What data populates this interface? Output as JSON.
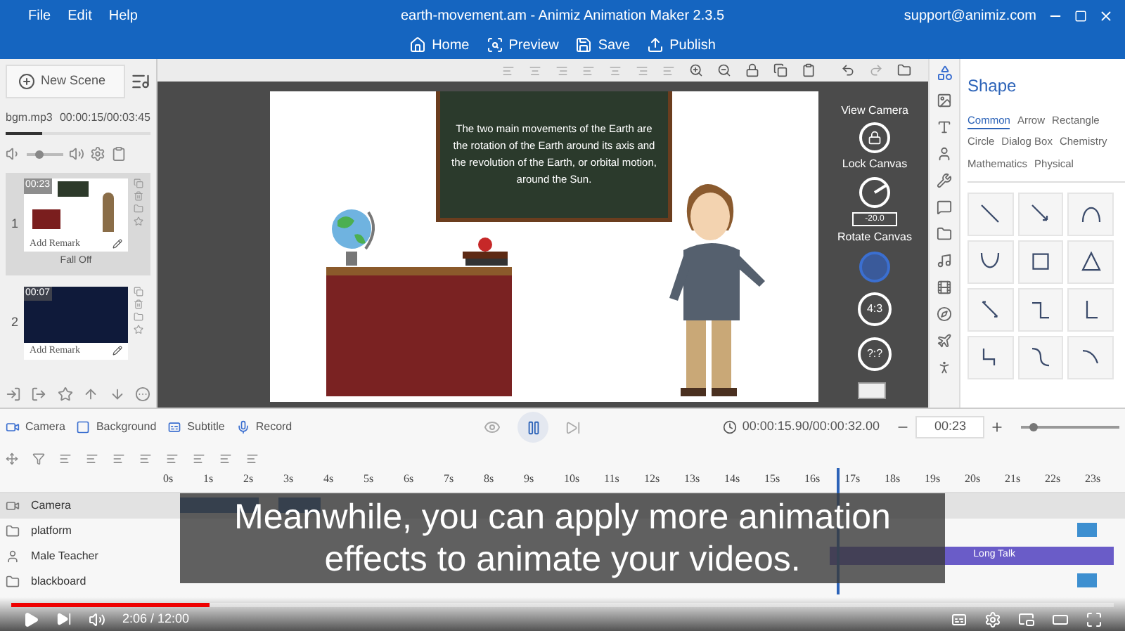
{
  "menu": [
    "File",
    "Edit",
    "Help"
  ],
  "window": {
    "title": "earth-movement.am - Animiz Animation Maker 2.3.5",
    "account": "support@animiz.com"
  },
  "toolbar": [
    {
      "label": "Home",
      "kind": "home"
    },
    {
      "label": "Preview",
      "kind": "preview"
    },
    {
      "label": "Save",
      "kind": "save"
    },
    {
      "label": "Publish",
      "kind": "publish"
    }
  ],
  "scene_panel": {
    "new_scene": "New Scene",
    "music": {
      "file": "bgm.mp3",
      "time": "00:00:15/00:03:45",
      "level": 0.25
    },
    "volume": {
      "level": 0.3
    },
    "scenes": [
      {
        "number": "1",
        "duration": "00:23",
        "remark": "Add Remark",
        "transition": "Fall Off",
        "selected": true,
        "kind": "classroom"
      },
      {
        "number": "2",
        "duration": "00:07",
        "remark": "Add Remark",
        "selected": false,
        "kind": "night"
      }
    ]
  },
  "canvas": {
    "blackboard_text": "The two main movements of the Earth are the rotation of the Earth around its axis and the revolution of the Earth, or orbital motion, around the Sun."
  },
  "camera_controls": {
    "view_camera": "View Camera",
    "lock_canvas": "Lock Canvas",
    "rotate_value": "-20.0",
    "rotate_canvas": "Rotate Canvas",
    "ratios": [
      {
        "label": "4:3"
      },
      {
        "label": "?:?"
      }
    ]
  },
  "shape_panel": {
    "title": "Shape",
    "tabs": [
      {
        "label": "Common",
        "selected": true
      },
      {
        "label": "Arrow",
        "selected": false
      },
      {
        "label": "Rectangle",
        "selected": false
      },
      {
        "label": "Circle",
        "selected": false
      },
      {
        "label": "Dialog Box",
        "selected": false
      },
      {
        "label": "Chemistry",
        "selected": false
      },
      {
        "label": "Mathematics",
        "selected": false
      },
      {
        "label": "Physical",
        "selected": false
      }
    ]
  },
  "timeline": {
    "layers": [
      {
        "label": "Camera",
        "kind": "camera"
      },
      {
        "label": "Background",
        "kind": "background"
      },
      {
        "label": "Subtitle",
        "kind": "subtitle"
      },
      {
        "label": "Record",
        "kind": "record"
      }
    ],
    "time": "00:00:15.90/00:00:32.00",
    "duration": "00:23",
    "zoom": {
      "level": 0.1
    },
    "ruler": [
      "0s",
      "1s",
      "2s",
      "3s",
      "4s",
      "5s",
      "6s",
      "7s",
      "8s",
      "9s",
      "10s",
      "11s",
      "12s",
      "13s",
      "14s",
      "15s",
      "16s",
      "17s",
      "18s",
      "19s",
      "20s",
      "21s",
      "22s",
      "23s"
    ],
    "playhead": {
      "level": 0.695
    },
    "tracks": [
      {
        "name": "Camera",
        "kind": "camera",
        "selected": true
      },
      {
        "name": "platform",
        "kind": "object",
        "selected": false
      },
      {
        "name": "Male Teacher",
        "kind": "person",
        "selected": false,
        "clip": "Long Talk"
      },
      {
        "name": "blackboard",
        "kind": "object",
        "selected": false
      }
    ]
  },
  "caption": "Meanwhile, you can apply more animation effects to animate your videos.",
  "player": {
    "time": "2:06 / 12:00",
    "progress": {
      "level": 0.18
    }
  }
}
